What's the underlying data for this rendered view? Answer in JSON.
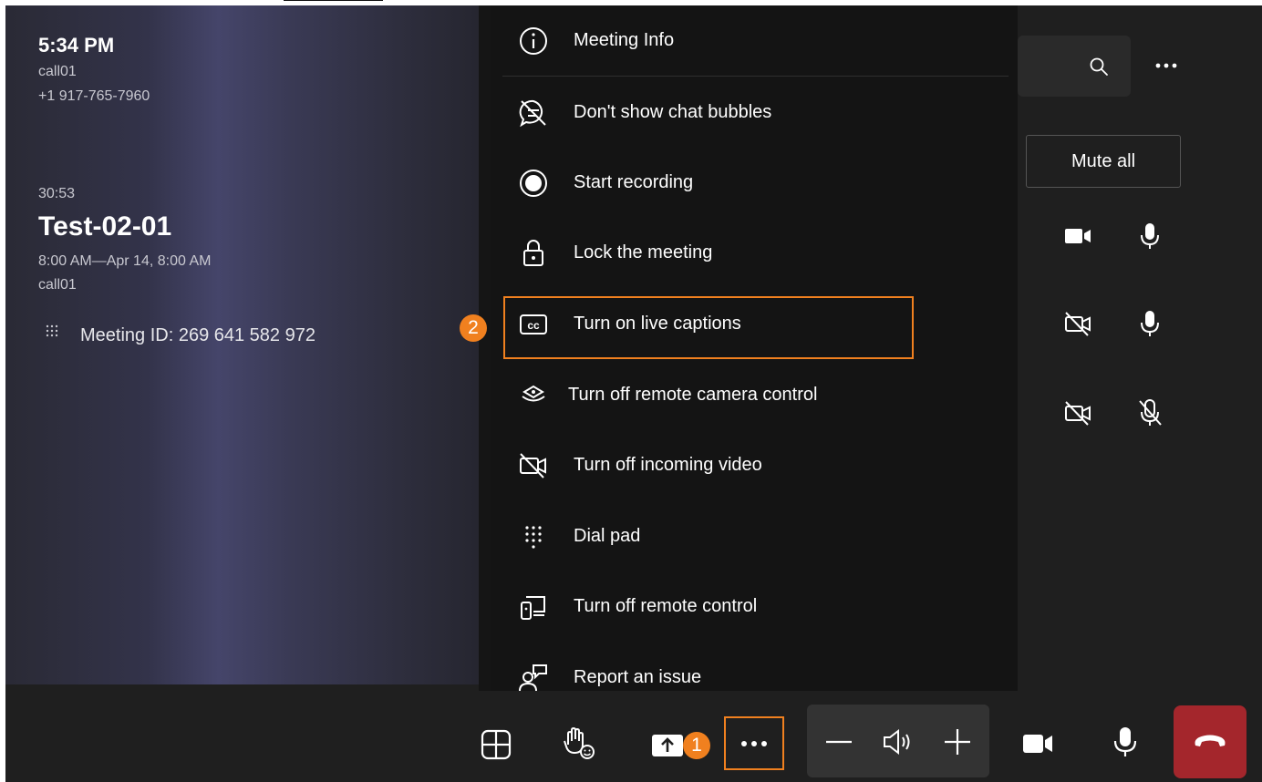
{
  "info": {
    "time": "5:34 PM",
    "caller": "call01",
    "phone": "+1 917-765-7960",
    "duration": "30:53",
    "meeting_title": "Test-02-01",
    "meeting_time": "8:00 AM—Apr 14, 8:00 AM",
    "organizer": "call01",
    "meeting_id": "Meeting ID:  269 641 582 972"
  },
  "participants": {
    "mute_all_label": "Mute all"
  },
  "menu": {
    "items": [
      {
        "label": "Meeting Info",
        "icon": "info-icon"
      },
      {
        "label": "Don't show chat bubbles",
        "icon": "chat-bubble-off-icon"
      },
      {
        "label": "Start recording",
        "icon": "record-icon"
      },
      {
        "label": "Lock the meeting",
        "icon": "lock-icon"
      },
      {
        "label": "Turn on live captions",
        "icon": "closed-captions-icon"
      },
      {
        "label": "Turn off remote camera control",
        "icon": "remote-camera-icon"
      },
      {
        "label": "Turn off incoming video",
        "icon": "video-off-icon"
      },
      {
        "label": "Dial pad",
        "icon": "dialpad-icon"
      },
      {
        "label": "Turn off remote control",
        "icon": "remote-control-icon"
      },
      {
        "label": "Report an issue",
        "icon": "report-issue-icon"
      }
    ]
  },
  "annotations": {
    "step1": "1",
    "step2": "2",
    "highlight_color": "#f0801f"
  },
  "colors": {
    "hangup": "#a4262c",
    "menu_bg": "#141414",
    "app_bg": "#1f1f1f"
  }
}
